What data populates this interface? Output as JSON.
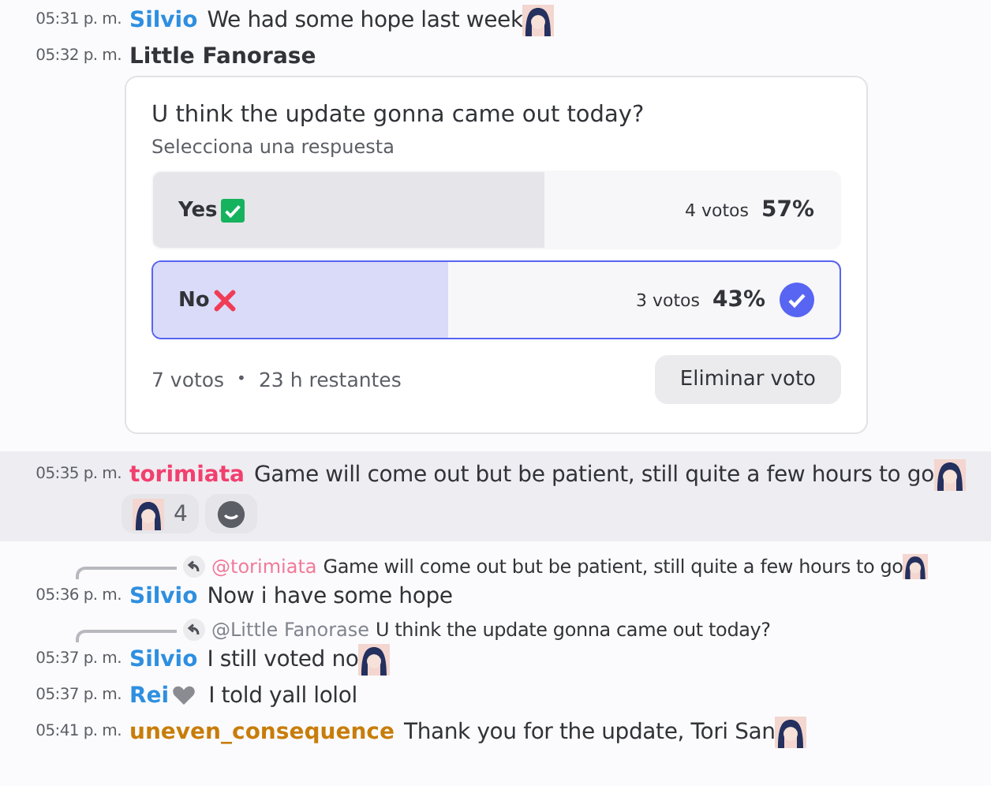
{
  "messages": [
    {
      "kind": "message",
      "time": "05:31 p. m.",
      "author": "Silvio",
      "color": "#2e8fe0",
      "text": "We had some hope last week",
      "emoji": true
    },
    {
      "kind": "poll",
      "time": "05:32 p. m.",
      "author": "Little Fanorase",
      "color": "#313338",
      "poll": {
        "question": "U think the update gonna came out today?",
        "subtitle": "Selecciona una respuesta",
        "options": [
          {
            "label": "Yes",
            "votes": "4 votos",
            "percent": "57%",
            "level": 0.57,
            "selected": false
          },
          {
            "label": "No",
            "votes": "3 votos",
            "percent": "43%",
            "level": 0.43,
            "selected": true
          }
        ],
        "total": "7 votos",
        "separator": "•",
        "remaining": "23 h restantes",
        "button": "Eliminar voto"
      }
    },
    {
      "kind": "message",
      "time": "05:35 p. m.",
      "author": "torimiata",
      "color": "#f23f6f",
      "text": "Game will come out but be patient, still quite a few hours to go",
      "emoji": true,
      "highlighted": true,
      "reactions": [
        {
          "emoji": true,
          "count": "4"
        }
      ]
    },
    {
      "kind": "message",
      "time": "05:36 p. m.",
      "author": "Silvio",
      "color": "#2e8fe0",
      "text": "Now i have some hope",
      "reply": {
        "mention": "@torimiata",
        "color": "#f27a98",
        "text": "Game will come out but be patient, still quite a few hours to go",
        "emoji": true
      }
    },
    {
      "kind": "message",
      "time": "05:37 p. m.",
      "author": "Silvio",
      "color": "#2e8fe0",
      "text": "I still voted no",
      "emoji": true,
      "reply": {
        "mention": "@Little Fanorase",
        "color": "#80848e",
        "text": "U think the update gonna came out today?"
      }
    },
    {
      "kind": "message",
      "time": "05:37 p. m.",
      "author": "Rei",
      "color": "#2e8fe0",
      "badge": true,
      "text": "I told yall lolol"
    },
    {
      "kind": "message",
      "time": "05:41 p. m.",
      "author": "uneven_consequence",
      "color": "#c87d0a",
      "text": "Thank you for the update, Tori San",
      "emoji": true
    }
  ]
}
